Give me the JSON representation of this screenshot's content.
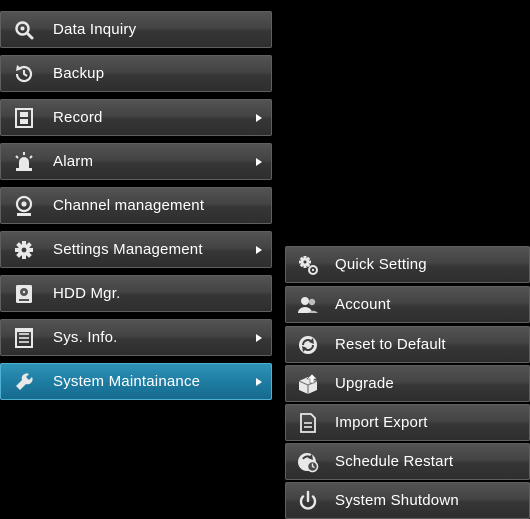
{
  "main_menu": {
    "items": [
      {
        "label": "Data Inquiry",
        "icon": "magnifier-icon",
        "submenu": false
      },
      {
        "label": "Backup",
        "icon": "clock-backup-icon",
        "submenu": false
      },
      {
        "label": "Record",
        "icon": "film-strip-icon",
        "submenu": true
      },
      {
        "label": "Alarm",
        "icon": "alarm-siren-icon",
        "submenu": true
      },
      {
        "label": "Channel management",
        "icon": "webcam-icon",
        "submenu": false
      },
      {
        "label": "Settings Management",
        "icon": "gear-icon",
        "submenu": true
      },
      {
        "label": "HDD Mgr.",
        "icon": "hdd-icon",
        "submenu": false
      },
      {
        "label": "Sys. Info.",
        "icon": "document-icon",
        "submenu": true
      },
      {
        "label": "System Maintainance",
        "icon": "wrench-icon",
        "submenu": true,
        "active": true
      }
    ]
  },
  "sub_menu": {
    "items": [
      {
        "label": "Quick Setting",
        "icon": "quick-setting-gears-icon"
      },
      {
        "label": "Account",
        "icon": "users-icon"
      },
      {
        "label": "Reset to Default",
        "icon": "reset-icon"
      },
      {
        "label": "Upgrade",
        "icon": "upgrade-icon"
      },
      {
        "label": "Import Export",
        "icon": "import-export-icon"
      },
      {
        "label": "Schedule Restart",
        "icon": "schedule-restart-icon"
      },
      {
        "label": "System Shutdown",
        "icon": "power-icon"
      }
    ]
  },
  "colors": {
    "background": "#000000",
    "item_gradient_top": "#545454",
    "item_gradient_bottom": "#2e2e2e",
    "active_top": "#2f93b7",
    "active_bottom": "#166a8d",
    "text": "#ffffff"
  }
}
